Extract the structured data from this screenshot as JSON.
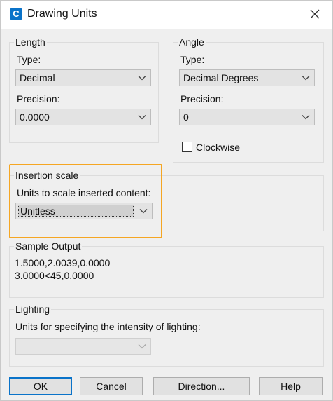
{
  "window": {
    "title": "Drawing Units"
  },
  "length": {
    "group_label": "Length",
    "type_label": "Type:",
    "type_value": "Decimal",
    "precision_label": "Precision:",
    "precision_value": "0.0000"
  },
  "angle": {
    "group_label": "Angle",
    "type_label": "Type:",
    "type_value": "Decimal Degrees",
    "precision_label": "Precision:",
    "precision_value": "0",
    "clockwise_label": "Clockwise",
    "clockwise_checked": false
  },
  "insertion": {
    "group_label": "Insertion scale",
    "units_label": "Units to scale inserted content:",
    "units_value": "Unitless"
  },
  "sample": {
    "group_label": "Sample Output",
    "line1": "1.5000,2.0039,0.0000",
    "line2": "3.0000<45,0.0000"
  },
  "lighting": {
    "group_label": "Lighting",
    "units_label": "Units for specifying the intensity of lighting:",
    "units_value": ""
  },
  "buttons": {
    "ok": "OK",
    "cancel": "Cancel",
    "direction": "Direction...",
    "help": "Help"
  },
  "colors": {
    "highlight": "#f5a623",
    "app_icon": "#0a73c9",
    "default_button_border": "#0a73c9"
  },
  "icons": {
    "app": "autocad-c-icon",
    "close": "close-icon",
    "dropdown": "chevron-down-icon"
  }
}
